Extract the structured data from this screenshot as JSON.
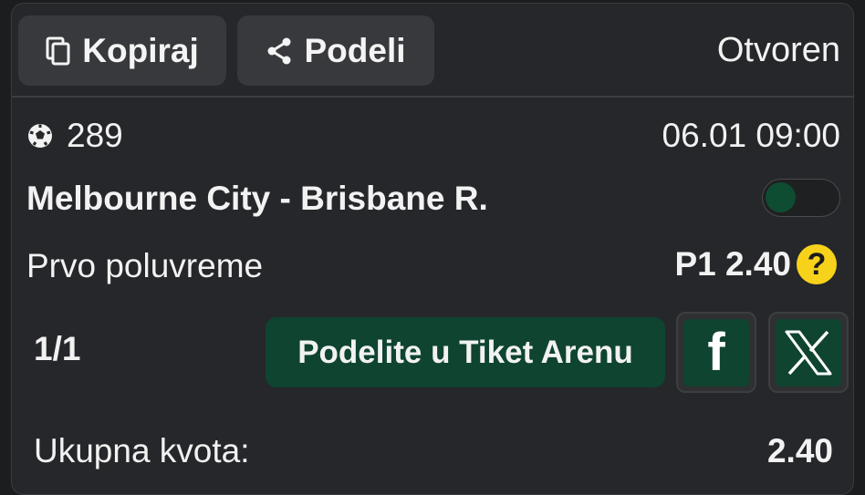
{
  "header": {
    "copy_label": "Kopiraj",
    "share_label": "Podeli",
    "status": "Otvoren"
  },
  "event": {
    "id": "289",
    "time": "06.01 09:00",
    "match": "Melbourne City - Brisbane R.",
    "market": "Prvo poluvreme",
    "pick": "P1 2.40",
    "help_symbol": "?"
  },
  "footer": {
    "count": "1/1",
    "arena_label": "Podelite u Tiket Arenu",
    "facebook_symbol": "f",
    "total_label": "Ukupna kvota:",
    "total_value": "2.40"
  },
  "icons": {
    "copy": "copy-icon",
    "share": "share-icon",
    "sport": "soccer-ball-icon",
    "facebook": "facebook-icon",
    "x": "x-logo-icon"
  },
  "colors": {
    "accent_green": "#0f4430",
    "help_yellow": "#f6d21b"
  }
}
